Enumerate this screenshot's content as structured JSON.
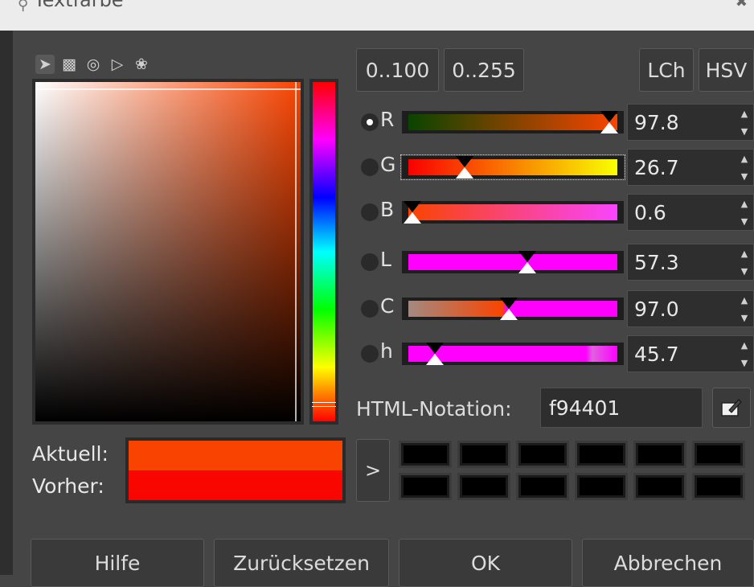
{
  "window": {
    "title": "Textfarbe"
  },
  "selector_tabs": [
    "gimp-selector",
    "watercolor-selector",
    "wheel-selector",
    "triangle-selector",
    "palette-selector"
  ],
  "range_buttons": {
    "pct": "0..100",
    "byte": "0..255"
  },
  "model_buttons": {
    "lch": "LCh",
    "hsv": "HSV"
  },
  "channels": [
    {
      "label": "R",
      "value": "97.8",
      "selected": true
    },
    {
      "label": "G",
      "value": "26.7",
      "selected": false
    },
    {
      "label": "B",
      "value": "0.6",
      "selected": false
    },
    {
      "label": "L",
      "value": "57.3",
      "selected": false
    },
    {
      "label": "C",
      "value": "97.0",
      "selected": false
    },
    {
      "label": "h",
      "value": "45.7",
      "selected": false
    }
  ],
  "html_notation": {
    "label": "HTML-Notation:",
    "value": "f94401"
  },
  "current": {
    "label": "Aktuell:",
    "color": "#f94401"
  },
  "previous": {
    "label": "Vorher:",
    "color": "#f90601"
  },
  "history_arrow": ">",
  "history_colors": [
    "#000000",
    "#000000",
    "#000000",
    "#000000",
    "#000000",
    "#000000",
    "#000000",
    "#000000",
    "#000000",
    "#000000",
    "#000000",
    "#000000"
  ],
  "buttons": {
    "help": "Hilfe",
    "reset": "Zurücksetzen",
    "ok": "OK",
    "cancel": "Abbrechen"
  }
}
